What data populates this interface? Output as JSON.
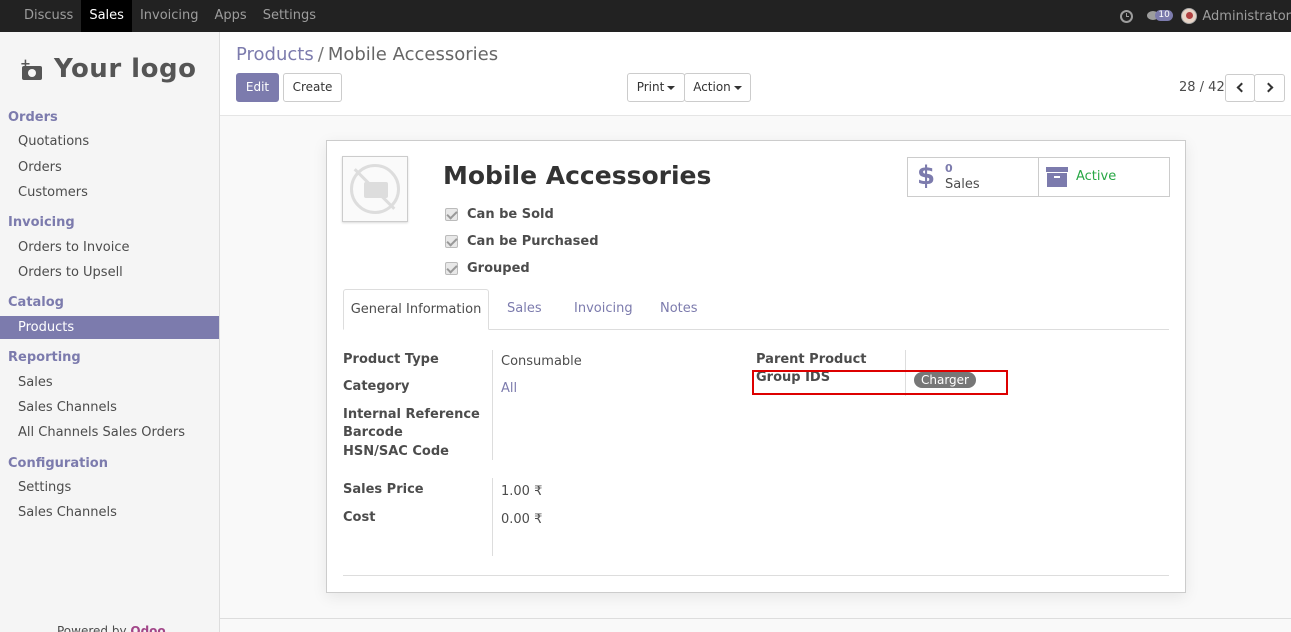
{
  "topnav": {
    "menu": [
      "Discuss",
      "Sales",
      "Invoicing",
      "Apps",
      "Settings"
    ],
    "active": "Sales",
    "chat_badge": "10",
    "user_name": "Administrator"
  },
  "sidebar": {
    "logo_text": "Your logo",
    "sections": [
      {
        "title": "Orders",
        "items": [
          "Quotations",
          "Orders",
          "Customers"
        ]
      },
      {
        "title": "Invoicing",
        "items": [
          "Orders to Invoice",
          "Orders to Upsell"
        ]
      },
      {
        "title": "Catalog",
        "items": [
          "Products"
        ]
      },
      {
        "title": "Reporting",
        "items": [
          "Sales",
          "Sales Channels",
          "All Channels Sales Orders"
        ]
      },
      {
        "title": "Configuration",
        "items": [
          "Settings",
          "Sales Channels"
        ]
      }
    ],
    "active_item": "Products",
    "powered_by": "Powered by",
    "powered_brand": "Odoo"
  },
  "breadcrumb": {
    "parent": "Products",
    "separator": "/",
    "current": "Mobile Accessories"
  },
  "toolbar": {
    "edit": "Edit",
    "create": "Create",
    "print": "Print",
    "action": "Action"
  },
  "pager": {
    "value": "28 / 42"
  },
  "form": {
    "title": "Mobile Accessories",
    "checkboxes": [
      {
        "label": "Can be Sold",
        "checked": true
      },
      {
        "label": "Can be Purchased",
        "checked": true
      },
      {
        "label": "Grouped",
        "checked": true
      }
    ],
    "smart_buttons": {
      "sales": {
        "count": "0",
        "label": "Sales",
        "icon": "dollar-icon"
      },
      "active": {
        "label": "Active",
        "icon": "archive-icon",
        "color": "#28a745"
      }
    },
    "tabs": [
      "General Information",
      "Sales",
      "Invoicing",
      "Notes"
    ],
    "active_tab": "General Information",
    "fields_left": {
      "product_type": {
        "label": "Product Type",
        "value": "Consumable"
      },
      "category": {
        "label": "Category",
        "value": "All"
      },
      "internal_reference": {
        "label": "Internal Reference",
        "value": ""
      },
      "barcode": {
        "label": "Barcode",
        "value": ""
      },
      "hsn": {
        "label": "HSN/SAC Code",
        "value": ""
      },
      "sales_price": {
        "label": "Sales Price",
        "value": "1.00 ₹"
      },
      "cost": {
        "label": "Cost",
        "value": "0.00 ₹"
      }
    },
    "fields_right": {
      "parent_product": {
        "label": "Parent Product",
        "value": ""
      },
      "group_ids": {
        "label": "Group IDS",
        "tag": "Charger"
      }
    }
  },
  "colors": {
    "brand": "#7c7bad",
    "highlight_box": "#dd0000",
    "success": "#28a745"
  }
}
